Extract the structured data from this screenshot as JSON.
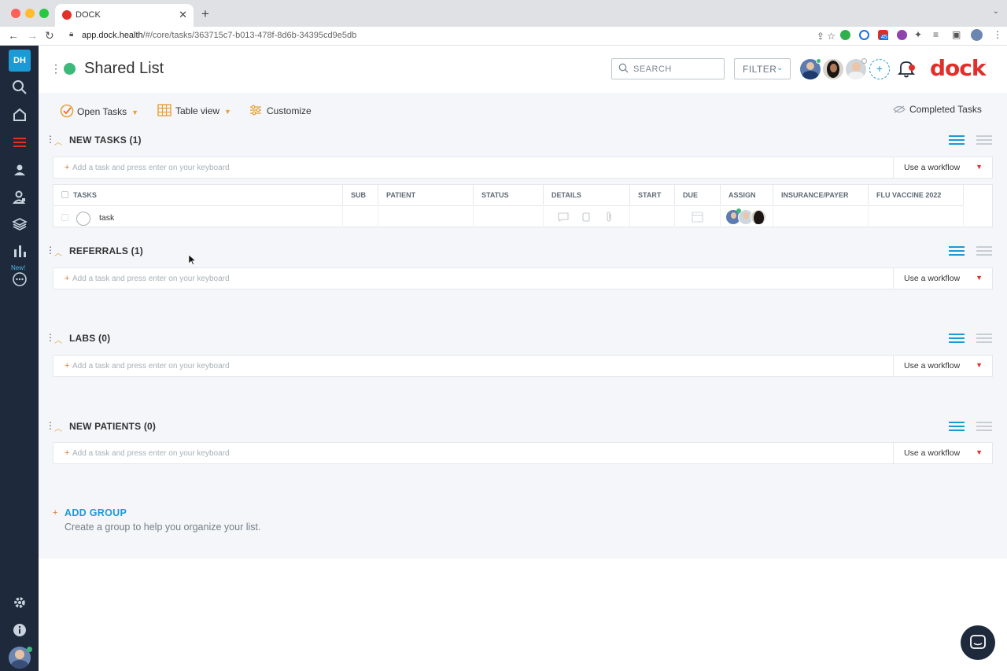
{
  "browser": {
    "tab_title": "DOCK",
    "url_host": "app.dock.health",
    "url_path": "/#/core/tasks/363715c7-b013-478f-8d6b-34395cd9e5db",
    "ext_badge": "45"
  },
  "sidebar": {
    "logo": "DH",
    "new_label": "New!"
  },
  "header": {
    "title": "Shared List",
    "search_placeholder": "SEARCH",
    "filter_label": "FILTER",
    "brand": "dock"
  },
  "toolbar": {
    "open_tasks": "Open Tasks",
    "table_view": "Table view",
    "customize": "Customize",
    "completed_tasks": "Completed Tasks"
  },
  "add_task_placeholder": "Add a task and press enter on your keyboard",
  "workflow_label": "Use a workflow",
  "groups": [
    {
      "title": "NEW TASKS (1)"
    },
    {
      "title": "REFERRALS (1)"
    },
    {
      "title": "LABS (0)"
    },
    {
      "title": "NEW PATIENTS (0)"
    }
  ],
  "table": {
    "columns": [
      "TASKS",
      "SUB",
      "PATIENT",
      "STATUS",
      "DETAILS",
      "START",
      "DUE",
      "ASSIGN",
      "INSURANCE/PAYER",
      "FLU VACCINE 2022"
    ],
    "rows": [
      {
        "task": "task"
      }
    ]
  },
  "add_group": {
    "label": "ADD GROUP",
    "description": "Create a group to help you organize your list."
  },
  "colors": {
    "accent_blue": "#1b9ad6",
    "brand_red": "#e1302c",
    "orange": "#e8a23a",
    "status_green": "#3cb879",
    "sidebar_bg": "#1e2a3b"
  }
}
